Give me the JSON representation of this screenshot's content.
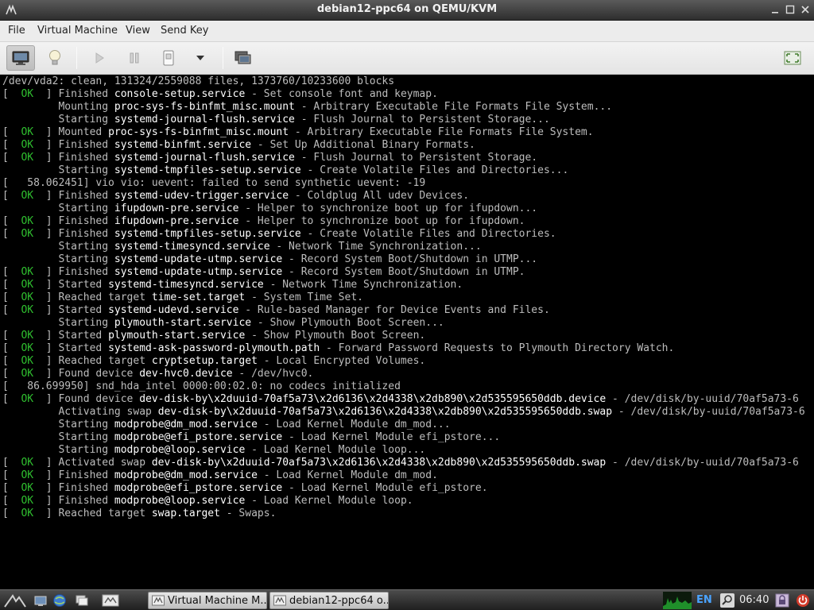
{
  "window": {
    "title": "debian12-ppc64 on QEMU/KVM"
  },
  "menu": [
    "File",
    "Virtual Machine",
    "View",
    "Send Key"
  ],
  "console": {
    "lines": [
      {
        "pre": "",
        "text": "/dev/vda2: clean, 131324/2559088 files, 1373760/10233600 blocks"
      },
      {
        "status": "OK",
        "verb": "Finished ",
        "unit": "console-setup.service",
        "desc": " - Set console font and keymap."
      },
      {
        "status": "",
        "verb": "Mounting ",
        "unit": "proc-sys-fs-binfmt_misc.mount",
        "desc": " - Arbitrary Executable File Formats File System..."
      },
      {
        "status": "",
        "verb": "Starting ",
        "unit": "systemd-journal-flush.service",
        "desc": " - Flush Journal to Persistent Storage..."
      },
      {
        "status": "OK",
        "verb": "Mounted ",
        "unit": "proc-sys-fs-binfmt_misc.mount",
        "desc": " - Arbitrary Executable File Formats File System."
      },
      {
        "status": "OK",
        "verb": "Finished ",
        "unit": "systemd-binfmt.service",
        "desc": " - Set Up Additional Binary Formats."
      },
      {
        "status": "OK",
        "verb": "Finished ",
        "unit": "systemd-journal-flush.service",
        "desc": " - Flush Journal to Persistent Storage."
      },
      {
        "status": "",
        "verb": "Starting ",
        "unit": "systemd-tmpfiles-setup.service",
        "desc": " - Create Volatile Files and Directories..."
      },
      {
        "pre": "",
        "text": "[   58.062451] vio vio: uevent: failed to send synthetic uevent: -19"
      },
      {
        "status": "OK",
        "verb": "Finished ",
        "unit": "systemd-udev-trigger.service",
        "desc": " - Coldplug All udev Devices."
      },
      {
        "status": "",
        "verb": "Starting ",
        "unit": "ifupdown-pre.service",
        "desc": " - Helper to synchronize boot up for ifupdown..."
      },
      {
        "status": "OK",
        "verb": "Finished ",
        "unit": "ifupdown-pre.service",
        "desc": " - Helper to synchronize boot up for ifupdown."
      },
      {
        "status": "OK",
        "verb": "Finished ",
        "unit": "systemd-tmpfiles-setup.service",
        "desc": " - Create Volatile Files and Directories."
      },
      {
        "status": "",
        "verb": "Starting ",
        "unit": "systemd-timesyncd.service",
        "desc": " - Network Time Synchronization..."
      },
      {
        "status": "",
        "verb": "Starting ",
        "unit": "systemd-update-utmp.service",
        "desc": " - Record System Boot/Shutdown in UTMP..."
      },
      {
        "status": "OK",
        "verb": "Finished ",
        "unit": "systemd-update-utmp.service",
        "desc": " - Record System Boot/Shutdown in UTMP."
      },
      {
        "status": "OK",
        "verb": "Started ",
        "unit": "systemd-timesyncd.service",
        "desc": " - Network Time Synchronization."
      },
      {
        "status": "OK",
        "verb": "Reached target ",
        "unit": "time-set.target",
        "desc": " - System Time Set."
      },
      {
        "status": "OK",
        "verb": "Started ",
        "unit": "systemd-udevd.service",
        "desc": " - Rule-based Manager for Device Events and Files."
      },
      {
        "status": "",
        "verb": "Starting ",
        "unit": "plymouth-start.service",
        "desc": " - Show Plymouth Boot Screen..."
      },
      {
        "status": "OK",
        "verb": "Started ",
        "unit": "plymouth-start.service",
        "desc": " - Show Plymouth Boot Screen."
      },
      {
        "status": "OK",
        "verb": "Started ",
        "unit": "systemd-ask-password-plymouth.path",
        "desc": " - Forward Password Requests to Plymouth Directory Watch."
      },
      {
        "status": "OK",
        "verb": "Reached target ",
        "unit": "cryptsetup.target",
        "desc": " - Local Encrypted Volumes."
      },
      {
        "status": "OK",
        "verb": "Found device ",
        "unit": "dev-hvc0.device",
        "desc": " - /dev/hvc0."
      },
      {
        "pre": "",
        "text": "[   86.699950] snd_hda_intel 0000:00:02.0: no codecs initialized"
      },
      {
        "status": "OK",
        "verb": "Found device ",
        "unit": "dev-disk-by\\x2duuid-70af5a73\\x2d6136\\x2d4338\\x2db890\\x2d535595650ddb.device",
        "desc": " - /dev/disk/by-uuid/70af5a73-6"
      },
      {
        "status": "",
        "verb": "Activating swap ",
        "unit": "dev-disk-by\\x2duuid-70af5a73\\x2d6136\\x2d4338\\x2db890\\x2d535595650ddb.swap",
        "desc": " - /dev/disk/by-uuid/70af5a73-6"
      },
      {
        "status": "",
        "verb": "Starting ",
        "unit": "modprobe@dm_mod.service",
        "desc": " - Load Kernel Module dm_mod..."
      },
      {
        "status": "",
        "verb": "Starting ",
        "unit": "modprobe@efi_pstore.service",
        "desc": " - Load Kernel Module efi_pstore..."
      },
      {
        "status": "",
        "verb": "Starting ",
        "unit": "modprobe@loop.service",
        "desc": " - Load Kernel Module loop..."
      },
      {
        "status": "OK",
        "verb": "Activated swap ",
        "unit": "dev-disk-by\\x2duuid-70af5a73\\x2d6136\\x2d4338\\x2db890\\x2d535595650ddb.swap",
        "desc": " - /dev/disk/by-uuid/70af5a73-6"
      },
      {
        "status": "OK",
        "verb": "Finished ",
        "unit": "modprobe@dm_mod.service",
        "desc": " - Load Kernel Module dm_mod."
      },
      {
        "status": "OK",
        "verb": "Finished ",
        "unit": "modprobe@efi_pstore.service",
        "desc": " - Load Kernel Module efi_pstore."
      },
      {
        "status": "OK",
        "verb": "Finished ",
        "unit": "modprobe@loop.service",
        "desc": " - Load Kernel Module loop."
      },
      {
        "status": "OK",
        "verb": "Reached target ",
        "unit": "swap.target",
        "desc": " - Swaps."
      }
    ]
  },
  "taskbar": {
    "tasks": [
      "Virtual Machine M...",
      "debian12-ppc64 o..."
    ],
    "keyboard_layout": "EN",
    "clock": "06:40"
  },
  "colors": {
    "ok_green": "#2fbf2f",
    "console_text": "#bdbdbd",
    "unit_white": "#ffffff"
  }
}
